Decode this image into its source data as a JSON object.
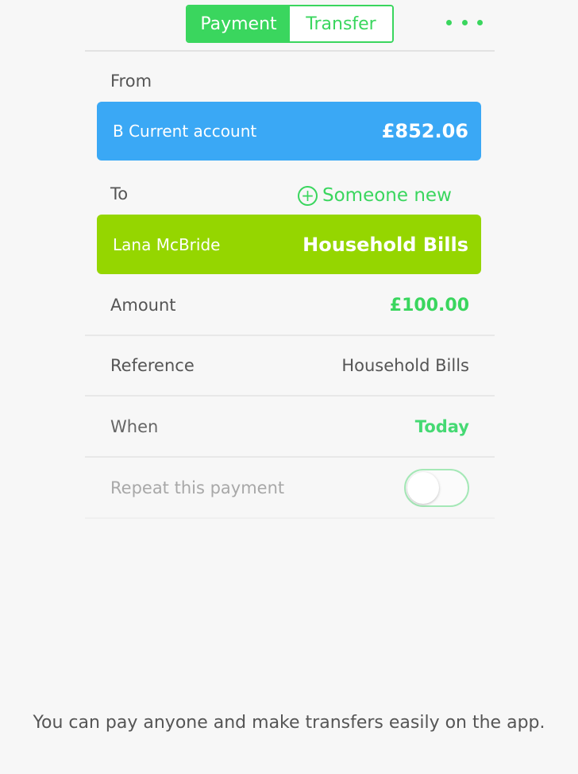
{
  "header": {
    "tabs": [
      {
        "label": "Payment",
        "active": true
      },
      {
        "label": "Transfer",
        "active": false
      }
    ],
    "more_icon": "more-icon"
  },
  "from": {
    "label": "From",
    "account_name": "B Current account",
    "balance": "£852.06"
  },
  "to": {
    "label": "To",
    "someone_new": "Someone new",
    "recipient_name": "Lana McBride",
    "recipient_account": "Household Bills"
  },
  "amount": {
    "label": "Amount",
    "value": "£100.00"
  },
  "reference": {
    "label": "Reference",
    "value": "Household Bills"
  },
  "when": {
    "label": "When",
    "value": "Today"
  },
  "repeat": {
    "label": "Repeat this payment",
    "on": false
  },
  "caption": "You can pay anyone and make transfers easily on the app.",
  "colors": {
    "accent_green": "#3ad65e",
    "from_card": "#3aa8f5",
    "to_card": "#95d600"
  }
}
